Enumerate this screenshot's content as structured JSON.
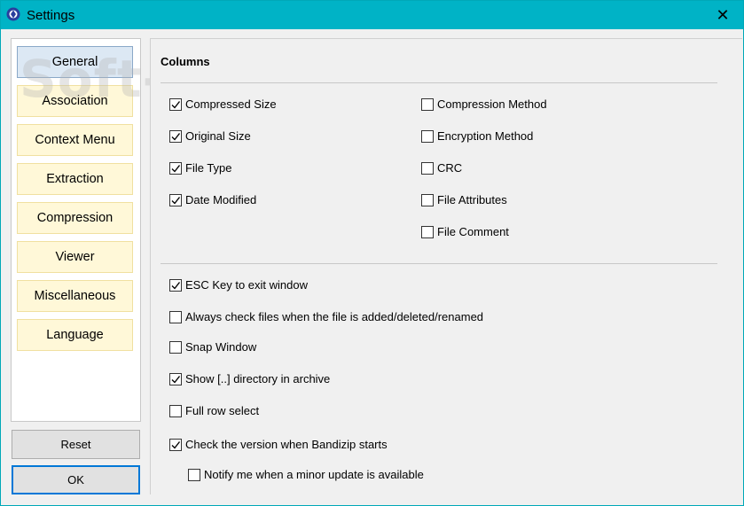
{
  "window": {
    "title": "Settings",
    "close_symbol": "✕"
  },
  "watermark": "Soft-D.com",
  "nav": {
    "items": [
      {
        "label": "General",
        "active": true
      },
      {
        "label": "Association",
        "active": false
      },
      {
        "label": "Context Menu",
        "active": false
      },
      {
        "label": "Extraction",
        "active": false
      },
      {
        "label": "Compression",
        "active": false
      },
      {
        "label": "Viewer",
        "active": false
      },
      {
        "label": "Miscellaneous",
        "active": false
      },
      {
        "label": "Language",
        "active": false
      }
    ]
  },
  "buttons": {
    "reset": "Reset",
    "ok": "OK"
  },
  "columns": {
    "title": "Columns",
    "left": [
      {
        "label": "Compressed Size",
        "checked": true
      },
      {
        "label": "Original Size",
        "checked": true
      },
      {
        "label": "File Type",
        "checked": true
      },
      {
        "label": "Date Modified",
        "checked": true
      }
    ],
    "right": [
      {
        "label": "Compression Method",
        "checked": false
      },
      {
        "label": "Encryption Method",
        "checked": false
      },
      {
        "label": "CRC",
        "checked": false
      },
      {
        "label": "File Attributes",
        "checked": false
      },
      {
        "label": "File Comment",
        "checked": false
      }
    ]
  },
  "options": [
    {
      "label": "ESC Key to exit window",
      "checked": true
    },
    {
      "label": "Always check files when the file is added/deleted/renamed",
      "checked": false
    },
    {
      "label": "Snap Window",
      "checked": false
    },
    {
      "label": "Show [..] directory in archive",
      "checked": true
    },
    {
      "label": "Full row select",
      "checked": false
    },
    {
      "label": "Check the version when Bandizip starts",
      "checked": true
    },
    {
      "label": "Notify me when a minor update is available",
      "checked": false
    }
  ],
  "colors": {
    "titlebar": "#00b3c6",
    "nav_bg": "#fff8d8",
    "nav_active": "#dce8f4",
    "accent": "#0078d7"
  }
}
